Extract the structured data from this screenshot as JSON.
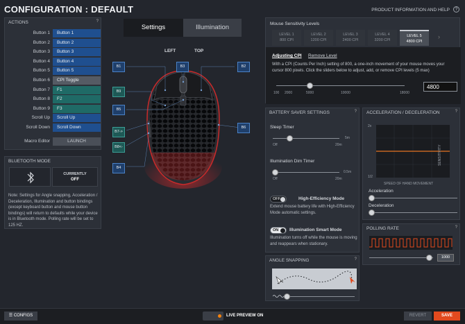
{
  "header": {
    "title": "CONFIGURATION : DEFAULT",
    "product_help": "PRODUCT INFORMATION AND HELP",
    "help_icon": "?"
  },
  "actions": {
    "title": "ACTIONS",
    "help": "?",
    "rows": [
      {
        "label": "Button 1",
        "value": "Button 1",
        "color": "blue"
      },
      {
        "label": "Button 2",
        "value": "Button 2",
        "color": "blue"
      },
      {
        "label": "Button 3",
        "value": "Button 3",
        "color": "blue"
      },
      {
        "label": "Button 4",
        "value": "Button 4",
        "color": "blue"
      },
      {
        "label": "Button 5",
        "value": "Button 5",
        "color": "blue"
      },
      {
        "label": "Button 6",
        "value": "CPI Toggle",
        "color": "gray"
      },
      {
        "label": "Button 7",
        "value": "F1",
        "color": "teal"
      },
      {
        "label": "Button 8",
        "value": "F2",
        "color": "teal"
      },
      {
        "label": "Button 9",
        "value": "F3",
        "color": "teal"
      },
      {
        "label": "Scroll Up",
        "value": "Scroll Up",
        "color": "blue"
      },
      {
        "label": "Scroll Down",
        "value": "Scroll Down",
        "color": "blue"
      }
    ],
    "macro_label": "Macro Editor",
    "launch": "LAUNCH"
  },
  "bluetooth": {
    "title": "BLUETOOTH MODE",
    "currently": "CURRENTLY",
    "state": "OFF",
    "note": "Note: Settings for Angle snapping, Acceleration / Deceleration, Illumination and button bindings (except keyboard button and mouse button bindings) will return to defaults while your device is in Bluetooth mode. Polling rate will be set to 125 HZ."
  },
  "center": {
    "tabs": [
      "Settings",
      "Illumination"
    ],
    "left": "LEFT",
    "top": "TOP",
    "buttons": [
      "B1",
      "B3",
      "B2",
      "B9",
      "B5",
      "B6",
      "B7->",
      "B8<-",
      "B4"
    ]
  },
  "sensitivity": {
    "title": "Mouse Sensitivity Levels",
    "levels": [
      {
        "name": "LEVEL 1",
        "cpi": "800 CPI"
      },
      {
        "name": "LEVEL 2",
        "cpi": "1200 CPI"
      },
      {
        "name": "LEVEL 3",
        "cpi": "2400 CPI"
      },
      {
        "name": "LEVEL 4",
        "cpi": "3200 CPI"
      },
      {
        "name": "LEVEL 5",
        "cpi": "4800 CPI"
      }
    ],
    "arrow": "›",
    "adjusting": "Adjusting CPI",
    "remove": "Remove Level",
    "desc": "With a CPI (Counts Per Inch) setting of 800, a one-inch movement of your mouse moves your cursor 800 pixels. Click the sliders below to adjust, add, or remove CPI levels (5 max)",
    "ticks": [
      "100",
      "2000",
      "5000",
      "10000",
      "18000"
    ],
    "value": "4800"
  },
  "battery": {
    "title": "BATTERY SAVER SETTINGS",
    "help": "?",
    "sleep": "Sleep Timer",
    "sleep_max": "5m",
    "off": "Off",
    "max_time": "20m",
    "dim": "Illumination Dim Timer",
    "dim_max": "0.5m",
    "hi_eff": "High-Efficiency Mode",
    "hi_eff_state": "OFF",
    "hi_eff_desc": "Extend mouse battery life with High-Efficiency Mode automatic settings.",
    "smart": "Illumination Smart Mode",
    "smart_state": "ON",
    "smart_desc": "Illumination turns off while the mouse is moving and reappears when stationary."
  },
  "accel": {
    "title": "ACCELERATION / DECELERATION",
    "help": "?",
    "y_top": "2x",
    "y_bot": "1/2",
    "sens": "SENSITIVITY",
    "speed": "SPEED OF HAND MOVEMENT",
    "accel": "Acceleration",
    "decel": "Deceleration"
  },
  "polling": {
    "title": "POLLING RATE",
    "help": "?",
    "value": "1000"
  },
  "angle": {
    "title": "ANGLE SNAPPING",
    "help": "?"
  },
  "bottom": {
    "configs": "CONFIGS",
    "live": "LIVE PREVIEW ON",
    "revert": "REVERT",
    "save": "SAVE"
  }
}
